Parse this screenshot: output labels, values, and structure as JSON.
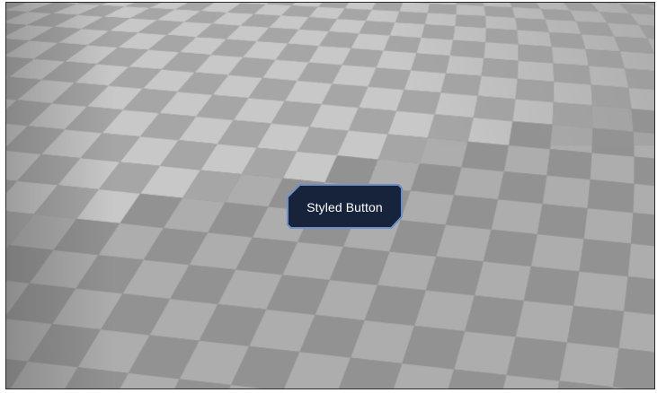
{
  "viewport": {
    "scene": "checkerboard-floor-3d",
    "colors": {
      "floor_light": "#c8c8c8",
      "floor_dark": "#a6a6a6",
      "floor_shadow_light": "#adadad",
      "floor_shadow_dark": "#929292"
    }
  },
  "button": {
    "label": "Styled Button",
    "colors": {
      "fill": "#17233a",
      "border": "#6d8fc4"
    }
  }
}
